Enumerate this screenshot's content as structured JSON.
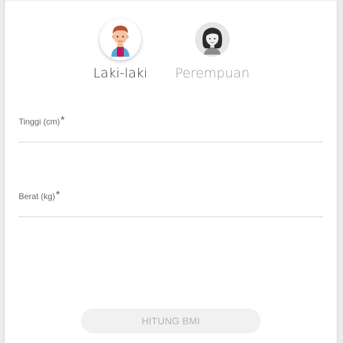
{
  "gender": {
    "male": {
      "label": "Laki-laki",
      "icon": "male-avatar-icon",
      "selected": true
    },
    "female": {
      "label": "Perempuan",
      "icon": "female-avatar-icon",
      "selected": false
    }
  },
  "form": {
    "height": {
      "label": "Tinggi (cm)",
      "required_mark": "*",
      "value": ""
    },
    "weight": {
      "label": "Berat (kg)",
      "required_mark": "*",
      "value": ""
    }
  },
  "submit": {
    "label": "HITUNG BMI",
    "enabled": false
  },
  "colors": {
    "background": "#ececec",
    "card": "#ffffff",
    "button_disabled_bg": "#f1f1f1",
    "button_disabled_text": "#b3b3b3"
  }
}
